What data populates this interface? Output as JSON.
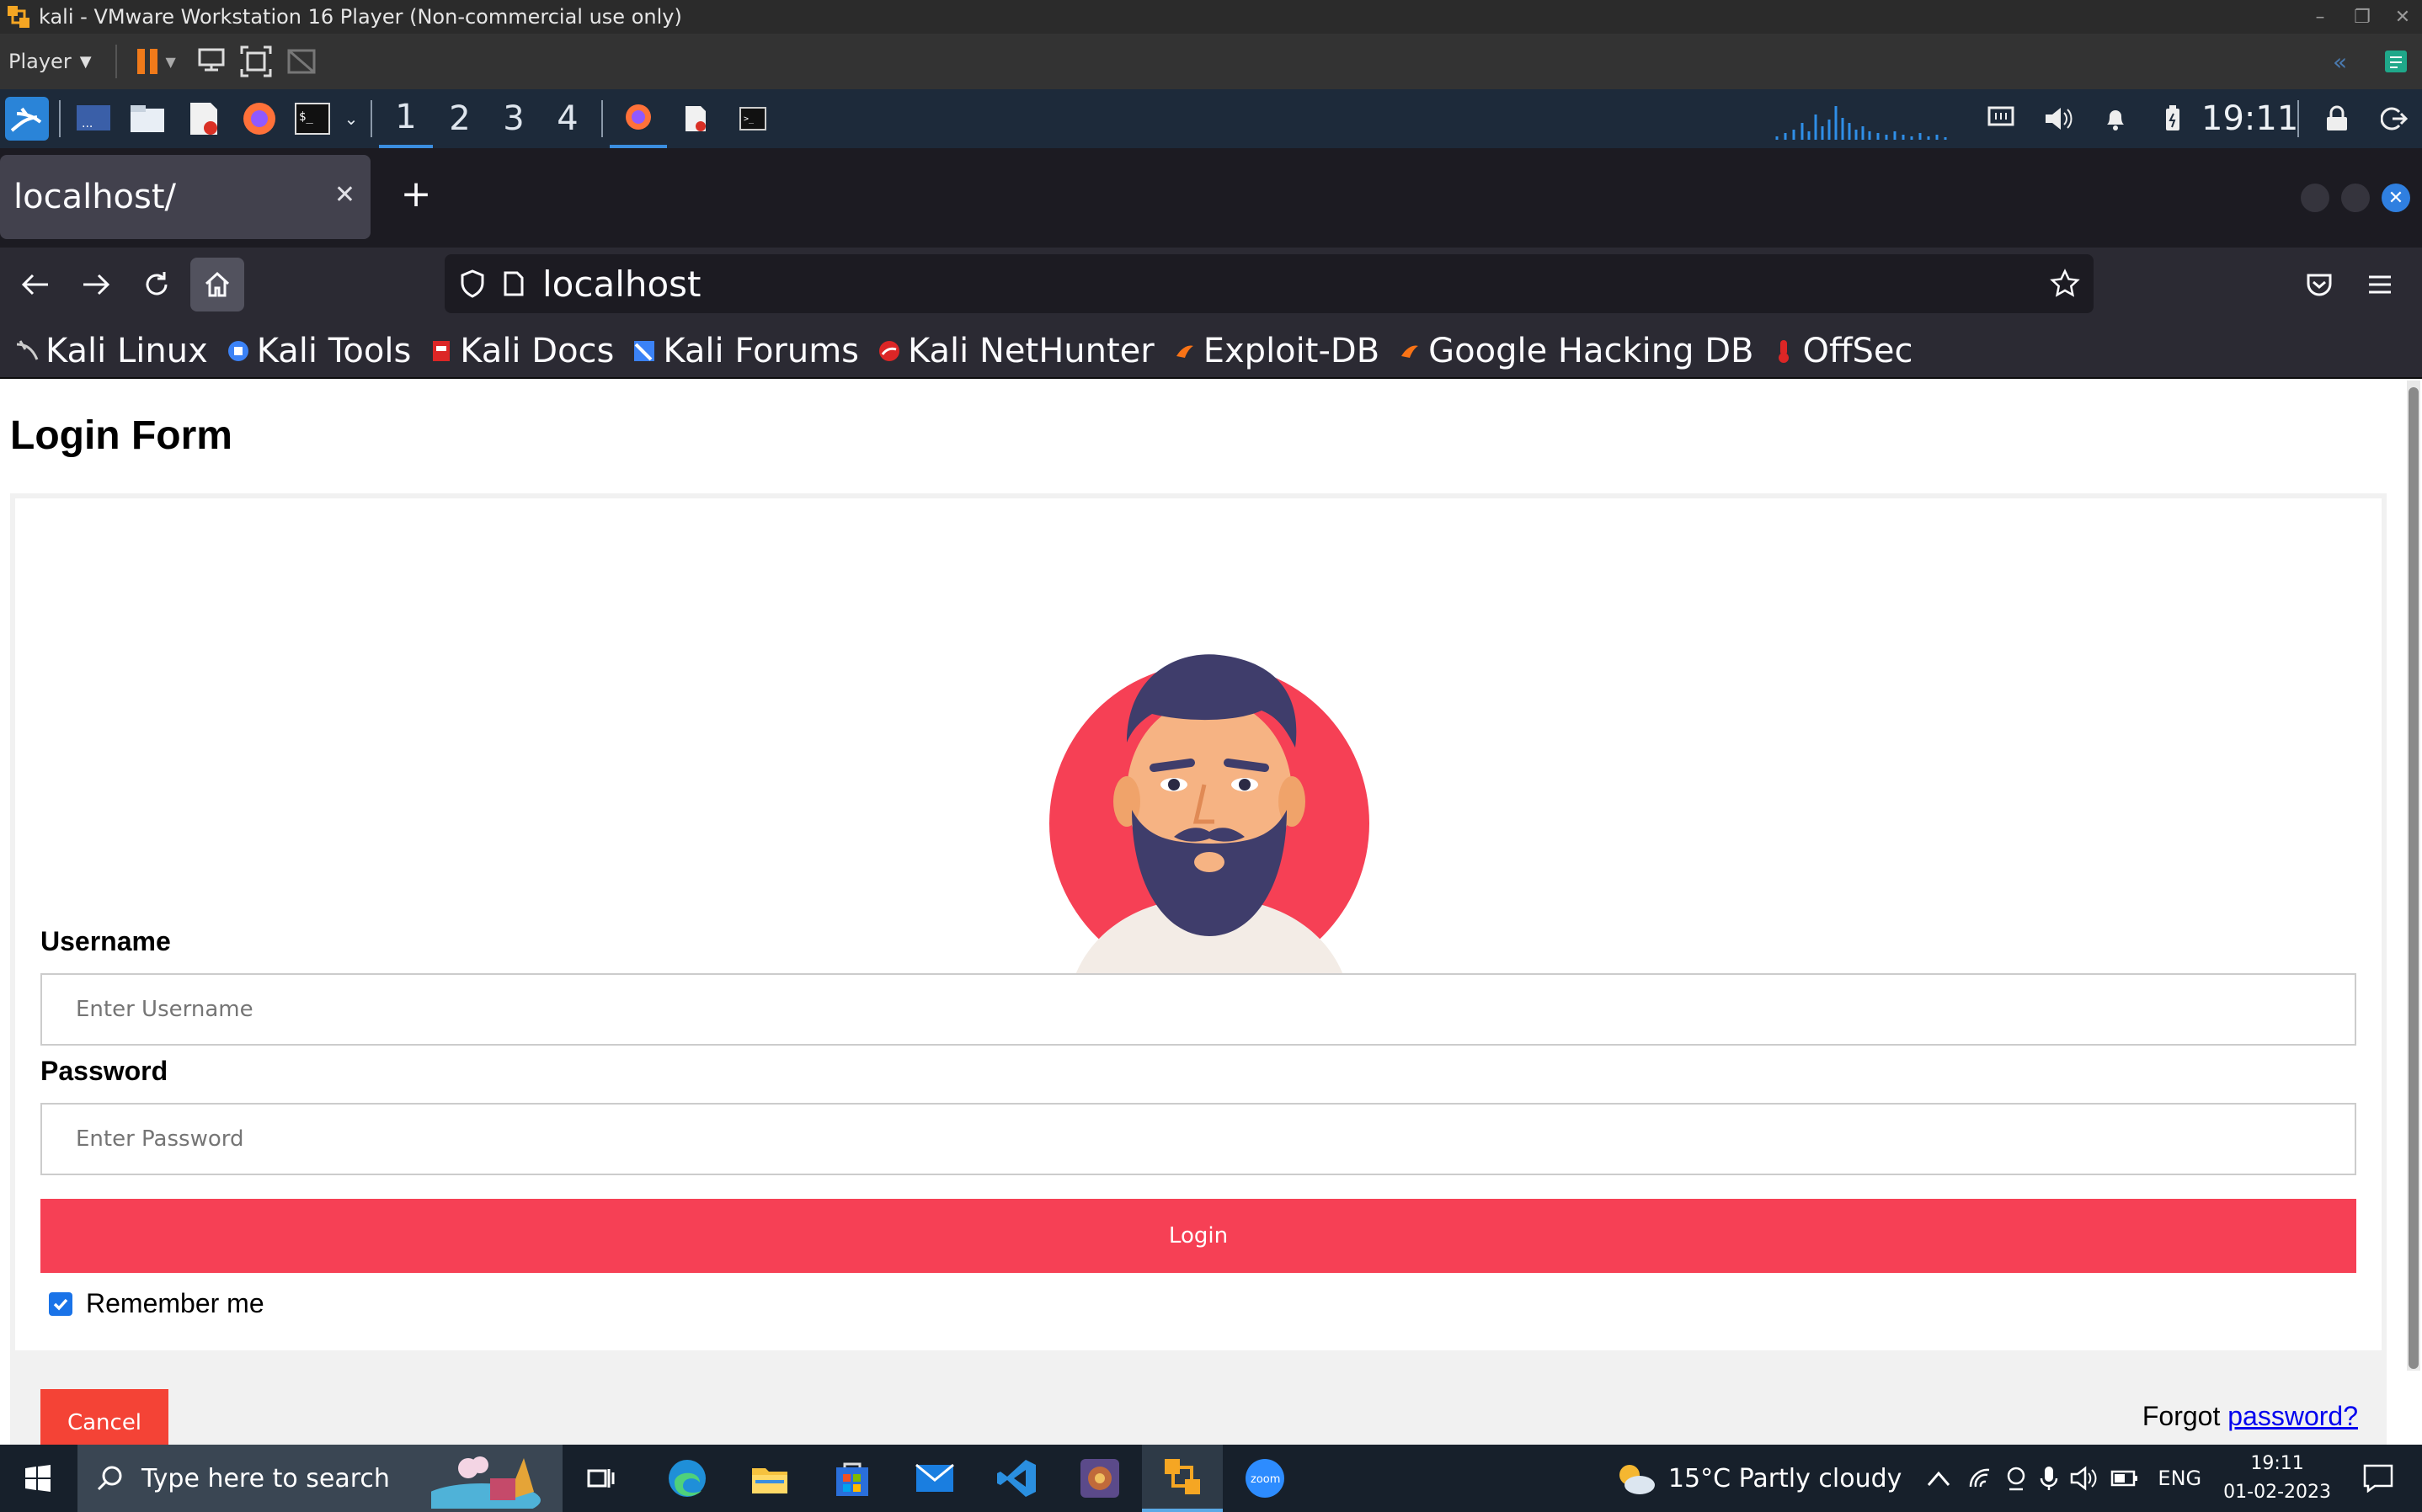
{
  "vmware": {
    "title": "kali  - VMware Workstation 16 Player (Non-commercial use only)",
    "player_menu": "Player",
    "icons": [
      "vmware-logo-icon",
      "pause-icon",
      "send-ctrl-alt-del-icon",
      "fullscreen-icon",
      "unity-icon"
    ]
  },
  "kali_panel": {
    "workspaces": [
      "1",
      "2",
      "3",
      "4"
    ],
    "active_workspace": "1",
    "clock": "19:11"
  },
  "browser": {
    "tab_title": "localhost/",
    "url": "localhost",
    "bookmarks": [
      {
        "label": "Kali Linux",
        "icon": "kali-dragon-icon",
        "color": "#cccccc"
      },
      {
        "label": "Kali Tools",
        "icon": "kali-tools-icon",
        "color": "#3b82f6"
      },
      {
        "label": "Kali Docs",
        "icon": "kali-docs-icon",
        "color": "#dc2626"
      },
      {
        "label": "Kali Forums",
        "icon": "kali-forums-icon",
        "color": "#3b82f6"
      },
      {
        "label": "Kali NetHunter",
        "icon": "nethunter-icon",
        "color": "#dc2626"
      },
      {
        "label": "Exploit-DB",
        "icon": "exploit-db-icon",
        "color": "#f97316"
      },
      {
        "label": "Google Hacking DB",
        "icon": "ghdb-icon",
        "color": "#f97316"
      },
      {
        "label": "OffSec",
        "icon": "offsec-icon",
        "color": "#dc2626"
      }
    ]
  },
  "page": {
    "title": "Login Form",
    "username_label": "Username",
    "username_placeholder": "Enter Username",
    "password_label": "Password",
    "password_placeholder": "Enter Password",
    "login_button": "Login",
    "remember_label": "Remember me",
    "remember_checked": true,
    "cancel_button": "Cancel",
    "forgot_prefix": "Forgot ",
    "forgot_link": "password?",
    "accent_color": "#f64055",
    "cancel_color": "#f44336"
  },
  "taskbar": {
    "search_placeholder": "Type here to search",
    "weather": "15°C  Partly cloudy",
    "language": "ENG",
    "time": "19:11",
    "date": "01-02-2023",
    "apps": [
      "task-view-icon",
      "edge-icon",
      "file-explorer-icon",
      "store-icon",
      "mail-icon",
      "vscode-icon",
      "app-icon",
      "vmware-icon",
      "zoom-icon"
    ]
  }
}
